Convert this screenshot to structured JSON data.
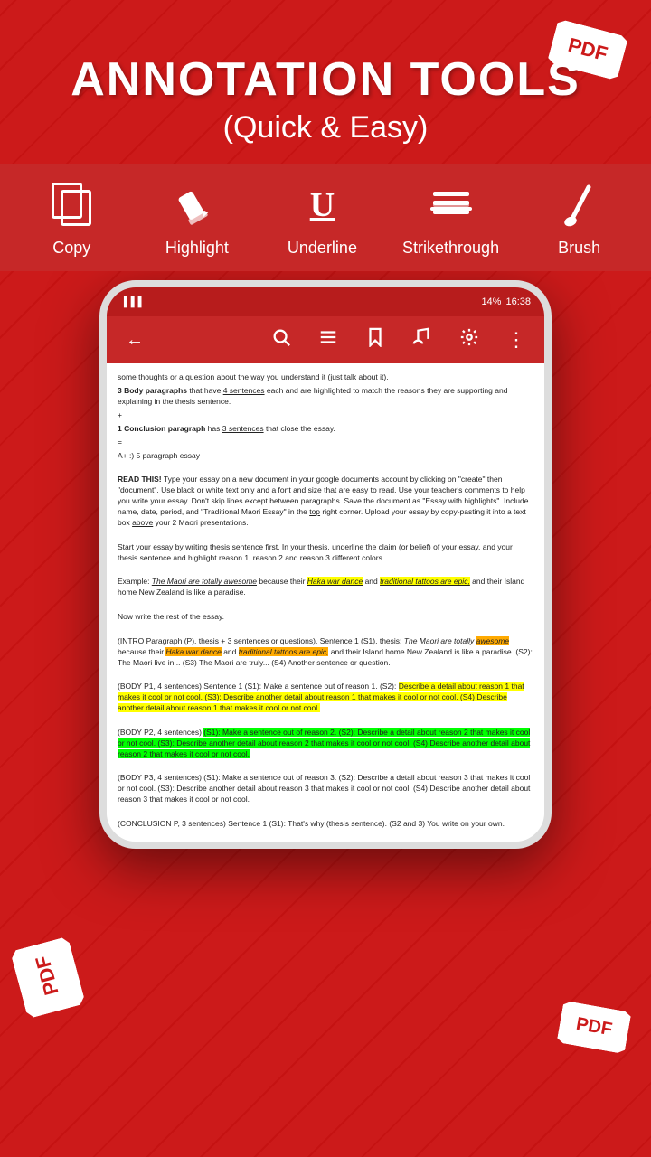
{
  "page": {
    "title": "ANNOTATION TOOLS",
    "subtitle": "(Quick & Easy)",
    "bg_color": "#cc1a1a"
  },
  "pdf_badges": {
    "top_right": "PDF",
    "bottom_left": "PDF",
    "bottom_right": "PDF"
  },
  "phone": {
    "status_bar": {
      "time": "16:38",
      "battery": "14%",
      "signal": "|||"
    },
    "toolbar": {
      "back_icon": "←",
      "search_icon": "🔍",
      "menu_icon": "☰",
      "bookmark_icon": "🔖",
      "paint_icon": "🖌",
      "settings_icon": "⚙",
      "more_icon": "⋮"
    }
  },
  "annotation_tools": [
    {
      "id": "copy",
      "label": "Copy",
      "icon_type": "copy"
    },
    {
      "id": "highlight",
      "label": "Highlight",
      "icon_type": "highlight"
    },
    {
      "id": "underline",
      "label": "Underline",
      "icon_type": "underline"
    },
    {
      "id": "strikethrough",
      "label": "Strikethrough",
      "icon_type": "strikethrough"
    },
    {
      "id": "brush",
      "label": "Brush",
      "icon_type": "brush"
    }
  ],
  "document_content": {
    "intro": "some thoughts or a question about the way you understand it (just talk about it).",
    "body1": "3 Body paragraphs that have 4 sentences each and are highlighted to match the reasons they are supporting and explaining in the thesis sentence.",
    "body2": "+ 1 Conclusion paragraph has 3 sentences that close the essay.",
    "body3": "= A+ :) 5 paragraph essay",
    "read_this": "READ THIS! Type your essay on a new document in your google documents account by clicking on \"create\" then \"document\". Use black or white text only and a font and size that are easy to read. Use your teacher's comments to help you write your essay. Don't skip lines except between paragraphs. Save the document as \"Essay with highlights\". Include name, date, period, and \"Traditional Maori Essay\" in the top right corner. Upload your essay by copy-pasting it into a text box above your 2 Maori presentations.",
    "thesis": "Start your essay by writing thesis sentence first. In your thesis, underline the claim (or belief) of your essay, and your thesis sentence and highlight reason 1, reason 2 and reason 3 different colors.",
    "example": "Example: The Maori are totally awesome because their Haka war dance and traditional tattoos are epic, and their Island home New Zealand is like a paradise.",
    "write_rest": "Now write the rest of the essay.",
    "intro_para": "(INTRO Paragraph (P), thesis + 3 sentences or questions). Sentence 1 (S1), thesis: The Maori are totally awesome because their Haka war dance and traditional tattoos are epic, and their Island home New Zealand is like a paradise. (S2): The Maori live in... (S3) The Maori are truly... (S4) Another sentence or question.",
    "body_p1": "(BODY P1, 4 sentences) Sentence 1 (S1): Make a sentence out of reason 1. (S2): Describe a detail about reason 1 that makes it cool or not cool. (S3): Describe another detail about reason 1 that makes it cool or not cool. (S4) Describe another detail about reason 1 that makes it cool or not cool.",
    "body_p2": "(BODY P2, 4 sentences) (S1): Make a sentence out of reason 2. (S2): Describe a detail about reason 2 that makes it cool or not cool. (S3): Describe another detail about reason 2 that makes it cool or not cool. (S4) Describe another detail about reason 2 that makes it cool or not cool.",
    "body_p3": "(BODY P3, 4 sentences) (S1): Make a sentence out of reason 3. (S2): Describe a detail about reason 3 that makes it cool or not cool. (S3): Describe another detail about reason 3 that makes it cool or not cool. (S4) Describe another detail about reason 3 that makes it cool or not cool.",
    "conclusion": "(CONCLUSION P, 3 sentences) Sentence 1 (S1): That's why (thesis sentence). (S2 and 3) You write on your own."
  }
}
